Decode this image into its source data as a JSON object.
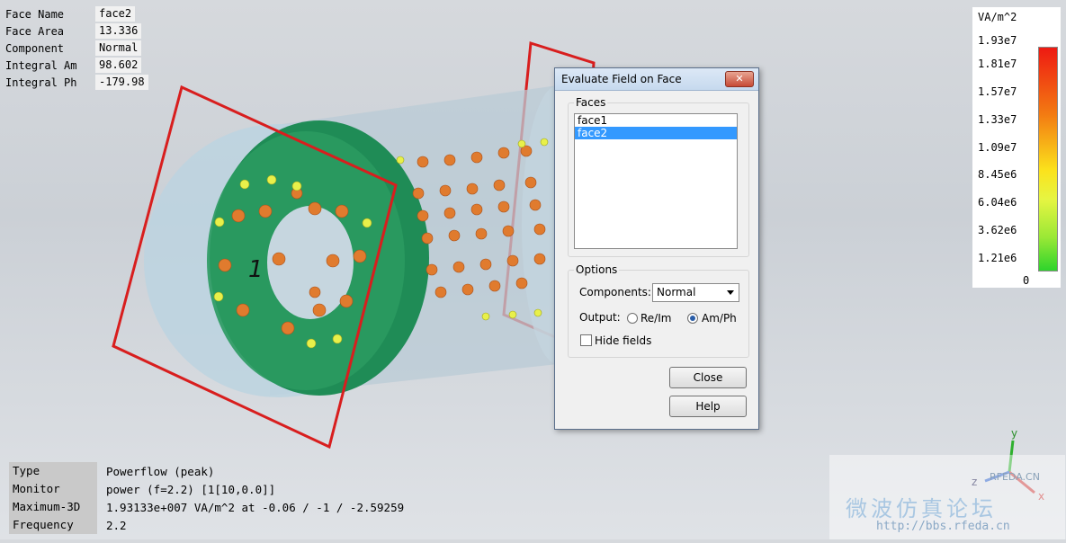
{
  "info_top": {
    "rows": [
      {
        "k": "Face Name",
        "v": "face2"
      },
      {
        "k": "Face Area",
        "v": "13.336"
      },
      {
        "k": "Component",
        "v": "Normal"
      },
      {
        "k": "Integral Am",
        "v": "98.602"
      },
      {
        "k": "Integral Ph",
        "v": "-179.98"
      }
    ]
  },
  "info_bottom": {
    "rows": [
      {
        "k": "Type",
        "v": "Powerflow (peak)"
      },
      {
        "k": "Monitor",
        "v": "power (f=2.2) [1[10,0.0]]"
      },
      {
        "k": "Maximum-3D",
        "v": "1.93133e+007 VA/m^2 at -0.06 / -1 / -2.59259"
      },
      {
        "k": "Frequency",
        "v": "2.2"
      }
    ]
  },
  "legend": {
    "title": "VA/m^2",
    "ticks": [
      "1.93e7",
      "1.81e7",
      "1.57e7",
      "1.33e7",
      "1.09e7",
      "8.45e6",
      "6.04e6",
      "3.62e6",
      "1.21e6",
      "0"
    ]
  },
  "viewport": {
    "port_label": "1",
    "axes": {
      "x": "x",
      "y": "y",
      "z": "z"
    }
  },
  "dialog": {
    "title": "Evaluate Field on Face",
    "close": "✕",
    "faces_label": "Faces",
    "faces": [
      "face1",
      "face2"
    ],
    "selected_face": "face2",
    "options_label": "Options",
    "components_label": "Components:",
    "components_value": "Normal",
    "output_label": "Output:",
    "output_reim": "Re/Im",
    "output_amph": "Am/Ph",
    "output_selected": "Am/Ph",
    "hide_fields": "Hide fields",
    "close_button": "Close",
    "help_button": "Help"
  },
  "watermark": {
    "line1": "微波仿真论坛",
    "url": "http://bbs.rfeda.cn",
    "logo": "RFEDA.CN"
  }
}
